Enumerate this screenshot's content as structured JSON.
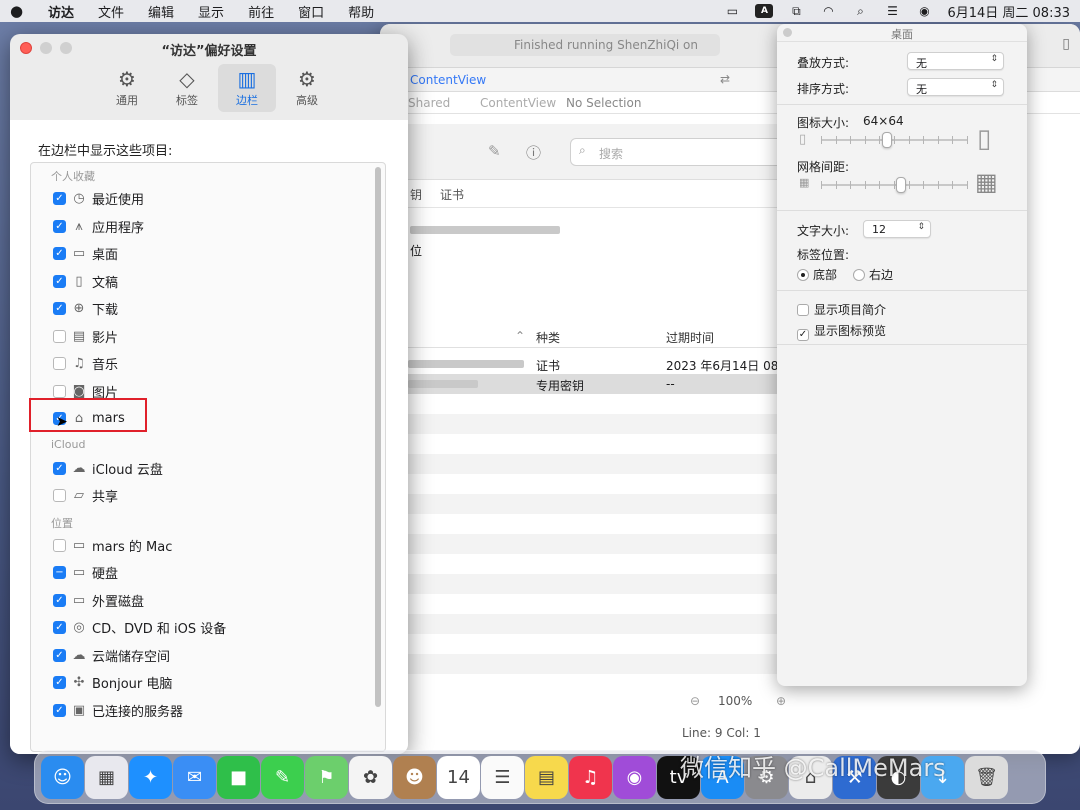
{
  "menubar": {
    "app": "访达",
    "items": [
      "文件",
      "编辑",
      "显示",
      "前往",
      "窗口",
      "帮助"
    ],
    "clock": "6月14日 周二  08:33"
  },
  "background_window": {
    "status": "Finished running ShenZhiQi on",
    "tab": "ContentView",
    "breadcrumb": [
      "Shared",
      "ContentView",
      "No Selection"
    ],
    "search_placeholder": "搜索",
    "categories": [
      "钥",
      "证书"
    ],
    "headline_partial": "位",
    "columns": [
      "种类",
      "过期时间"
    ],
    "rows": [
      {
        "kind": "证书",
        "expires": "2023 年6月14日 08:"
      },
      {
        "kind": "专用密钥",
        "expires": "--"
      }
    ],
    "zoom": "100%",
    "position": "Line: 9  Col: 1"
  },
  "prefs": {
    "title": "“访达”偏好设置",
    "tabs": [
      {
        "label": "通用",
        "icon": "gear-icon"
      },
      {
        "label": "标签",
        "icon": "tag-icon"
      },
      {
        "label": "边栏",
        "icon": "sidebar-icon"
      },
      {
        "label": "高级",
        "icon": "gears-icon"
      }
    ],
    "active_tab": "边栏",
    "section_label": "在边栏中显示这些项目:",
    "groups": [
      {
        "name": "个人收藏",
        "items": [
          {
            "label": "最近使用",
            "icon": "clock-icon",
            "checked": true
          },
          {
            "label": "应用程序",
            "icon": "apps-icon",
            "checked": true
          },
          {
            "label": "桌面",
            "icon": "desktop-icon",
            "checked": true
          },
          {
            "label": "文稿",
            "icon": "document-icon",
            "checked": true
          },
          {
            "label": "下载",
            "icon": "download-icon",
            "checked": true
          },
          {
            "label": "影片",
            "icon": "film-icon",
            "checked": false
          },
          {
            "label": "音乐",
            "icon": "music-icon",
            "checked": false
          },
          {
            "label": "图片",
            "icon": "camera-icon",
            "checked": false
          },
          {
            "label": "mars",
            "icon": "home-icon",
            "checked": true
          }
        ]
      },
      {
        "name": "iCloud",
        "items": [
          {
            "label": "iCloud 云盘",
            "icon": "cloud-icon",
            "checked": true
          },
          {
            "label": "共享",
            "icon": "shared-folder-icon",
            "checked": false
          }
        ]
      },
      {
        "name": "位置",
        "items": [
          {
            "label": "mars 的 Mac",
            "icon": "computer-icon",
            "checked": false
          },
          {
            "label": "硬盘",
            "icon": "disk-icon",
            "checked": "mixed"
          },
          {
            "label": "外置磁盘",
            "icon": "external-disk-icon",
            "checked": true
          },
          {
            "label": "CD、DVD 和 iOS 设备",
            "icon": "optical-disc-icon",
            "checked": true
          },
          {
            "label": "云端储存空间",
            "icon": "cloud-icon",
            "checked": true
          },
          {
            "label": "Bonjour 电脑",
            "icon": "bonjour-icon",
            "checked": true
          },
          {
            "label": "已连接的服务器",
            "icon": "server-icon",
            "checked": true
          }
        ]
      }
    ]
  },
  "view_options": {
    "title": "桌面",
    "stack_label": "叠放方式:",
    "stack_value": "无",
    "sort_label": "排序方式:",
    "sort_value": "无",
    "icon_size_label": "图标大小:",
    "icon_size_value": "64×64",
    "icon_size_level": 0.45,
    "grid_label": "网格间距:",
    "grid_level": 0.55,
    "text_size_label": "文字大小:",
    "text_size_value": "12",
    "label_pos_label": "标签位置:",
    "label_pos_bottom": "底部",
    "label_pos_right": "右边",
    "label_pos_selected": "底部",
    "show_info_label": "显示项目简介",
    "show_info": false,
    "show_preview_label": "显示图标预览",
    "show_preview": true
  },
  "dock": {
    "apps": [
      {
        "name": "finder-icon",
        "color": "#2a8cf0",
        "glyph": "☺"
      },
      {
        "name": "launchpad-icon",
        "color": "#e8e8ee",
        "glyph": "▦"
      },
      {
        "name": "safari-icon",
        "color": "#1e90ff",
        "glyph": "✦"
      },
      {
        "name": "mail-icon",
        "color": "#3a8ef5",
        "glyph": "✉"
      },
      {
        "name": "facetime-icon",
        "color": "#2fbf4a",
        "glyph": "■"
      },
      {
        "name": "messages-icon",
        "color": "#3ccf4e",
        "glyph": "✎"
      },
      {
        "name": "maps-icon",
        "color": "#6ccf6c",
        "glyph": "⚑"
      },
      {
        "name": "photos-icon",
        "color": "#f4f4f4",
        "glyph": "✿"
      },
      {
        "name": "contacts-icon",
        "color": "#b08050",
        "glyph": "☻"
      },
      {
        "name": "calendar-icon",
        "color": "#ffffff",
        "glyph": "14"
      },
      {
        "name": "reminders-icon",
        "color": "#fafafa",
        "glyph": "☰"
      },
      {
        "name": "notes-icon",
        "color": "#f7d94c",
        "glyph": "▤"
      },
      {
        "name": "music-icon",
        "color": "#f0344d",
        "glyph": "♫"
      },
      {
        "name": "podcasts-icon",
        "color": "#a04cd8",
        "glyph": "◉"
      },
      {
        "name": "tv-icon",
        "color": "#111111",
        "glyph": "tv"
      },
      {
        "name": "appstore-icon",
        "color": "#1a8cf5",
        "glyph": "A"
      },
      {
        "name": "settings-icon",
        "color": "#8a8a8e",
        "glyph": "⚙"
      },
      {
        "name": "keychain-icon",
        "color": "#ececec",
        "glyph": "⌂"
      },
      {
        "name": "xcode-icon",
        "color": "#2e6bd1",
        "glyph": "⚒"
      },
      {
        "name": "instruments-icon",
        "color": "#3b3b3b",
        "glyph": "◐"
      },
      {
        "name": "downloads-icon",
        "color": "#4aa8f0",
        "glyph": "↓"
      },
      {
        "name": "trash-icon",
        "color": "#dcdcdc",
        "glyph": "🗑"
      }
    ]
  },
  "watermark": "微信知乎 @CallMeMars"
}
